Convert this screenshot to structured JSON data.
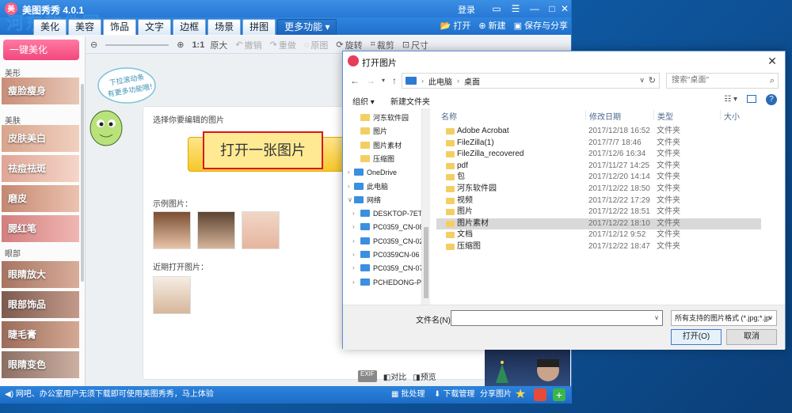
{
  "meitu": {
    "app_title": "美图秀秀 4.0.1",
    "login": "登录",
    "watermark": "河东软件园",
    "watermark_url": "www.pc0359.cn",
    "tabs": [
      "美化",
      "美容",
      "饰品",
      "文字",
      "边框",
      "场景",
      "拼图",
      "更多功能 ▾"
    ],
    "right_buttons": {
      "open": "打开",
      "new": "新建",
      "save": "保存与分享"
    },
    "options": {
      "zoom": "1:1",
      "original": "原大",
      "undo": "撤销",
      "redo": "重做",
      "reset": "原图",
      "rotate": "旋转",
      "crop": "裁剪",
      "size": "尺寸"
    },
    "sidebar": {
      "one_click": "一键美化",
      "categories": {
        "shape": "美形",
        "skin": "美肤",
        "eyes": "眼部"
      },
      "items": [
        "瘦脸瘦身",
        "皮肤美白",
        "祛痘祛斑",
        "磨皮",
        "腮红笔",
        "眼睛放大",
        "眼部饰品",
        "睫毛膏",
        "眼睛变色"
      ]
    },
    "mascot_bubble": "下拉滚动条有更多功能哦!",
    "panel": {
      "select_label": "选择你要编辑的图片",
      "open_button": "打开一张图片",
      "sample_label": "示例图片：",
      "recent_label": "近期打开图片："
    },
    "compare": {
      "exif": "EXIF",
      "compare": "对比",
      "preview": "预览"
    },
    "status": {
      "tip": "网吧、办公室用户无须下载即可使用美图秀秀，马上体验",
      "batch": "批处理",
      "download": "下载管理",
      "share": "分享图片"
    }
  },
  "dialog": {
    "title": "打开图片",
    "breadcrumb": [
      "此电脑",
      "桌面"
    ],
    "search_placeholder": "搜索\"桌面\"",
    "organize": "组织 ▾",
    "new_folder": "新建文件夹",
    "columns": {
      "name": "名称",
      "date": "修改日期",
      "type": "类型",
      "size": "大小"
    },
    "tree": [
      {
        "label": "河东软件园",
        "kind": "folder"
      },
      {
        "label": "图片",
        "kind": "folder"
      },
      {
        "label": "图片素材",
        "kind": "folder"
      },
      {
        "label": "压缩图",
        "kind": "folder"
      },
      {
        "label": "OneDrive",
        "kind": "cloud"
      },
      {
        "label": "此电脑",
        "kind": "pc"
      },
      {
        "label": "网络",
        "kind": "net"
      },
      {
        "label": "DESKTOP-7ETC",
        "kind": "pc"
      },
      {
        "label": "PC0359_CN-08",
        "kind": "pc"
      },
      {
        "label": "PC0359_CN-02",
        "kind": "pc"
      },
      {
        "label": "PC0359CN-06",
        "kind": "pc"
      },
      {
        "label": "PC0359_CN-07",
        "kind": "pc"
      },
      {
        "label": "PCHEDONG-PC",
        "kind": "pc"
      }
    ],
    "files": [
      {
        "name": "Adobe Acrobat",
        "date": "2017/12/18 16:52",
        "type": "文件夹"
      },
      {
        "name": "FileZilla(1)",
        "date": "2017/7/7 18:46",
        "type": "文件夹"
      },
      {
        "name": "FileZilla_recovered",
        "date": "2017/12/6 16:34",
        "type": "文件夹"
      },
      {
        "name": "pdf",
        "date": "2017/11/27 14:25",
        "type": "文件夹"
      },
      {
        "name": "包",
        "date": "2017/12/20 14:14",
        "type": "文件夹"
      },
      {
        "name": "河东软件园",
        "date": "2017/12/22 18:50",
        "type": "文件夹"
      },
      {
        "name": "视频",
        "date": "2017/12/22 17:29",
        "type": "文件夹"
      },
      {
        "name": "图片",
        "date": "2017/12/22 18:51",
        "type": "文件夹"
      },
      {
        "name": "图片素材",
        "date": "2017/12/22 18:10",
        "type": "文件夹"
      },
      {
        "name": "文档",
        "date": "2017/12/12 9:52",
        "type": "文件夹"
      },
      {
        "name": "压缩图",
        "date": "2017/12/22 18:47",
        "type": "文件夹"
      }
    ],
    "selected_index": 8,
    "filename_label": "文件名(N):",
    "filename_value": "",
    "filter": "所有支持的图片格式 (*.jpg;*.jp",
    "open_button": "打开(O)",
    "cancel_button": "取消"
  },
  "colors": {
    "accent": "#2779d6",
    "pink": "#f2477d",
    "folder": "#f3cf63"
  }
}
